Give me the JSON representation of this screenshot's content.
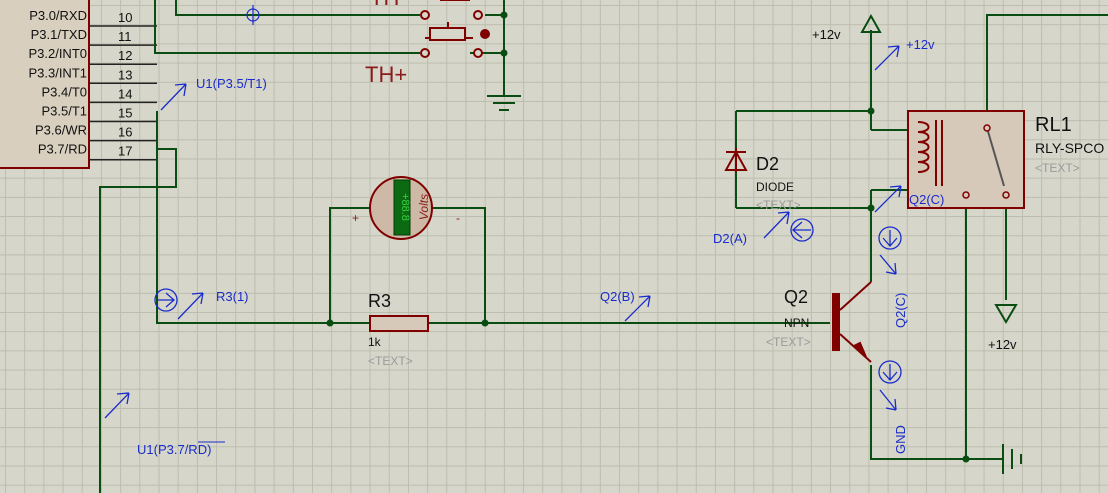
{
  "mcu": {
    "pins": [
      {
        "name": "P3.0/RXD",
        "num": "10"
      },
      {
        "name": "P3.1/TXD",
        "num": "11"
      },
      {
        "name": "P3.2/INT0",
        "num": "12"
      },
      {
        "name": "P3.3/INT1",
        "num": "13"
      },
      {
        "name": "P3.4/T0",
        "num": "14"
      },
      {
        "name": "P3.5/T1",
        "num": "15"
      },
      {
        "name": "P3.6/WR",
        "num": "16"
      },
      {
        "name": "P3.7/RD",
        "num": "17"
      }
    ]
  },
  "labels": {
    "th_minus": "TH-",
    "th_plus": "TH+",
    "u1_t1": "U1(P3.5/T1)",
    "u1_rd": "U1(P3.7/RD)",
    "r3_probe": "R3(1)",
    "q2b_probe": "Q2(B)",
    "d2a_probe": "D2(A)",
    "q2c_probe_top": "Q2(C)",
    "q2c_probe_side": "Q2(C)",
    "gnd_probe": "GND",
    "vcc_left": "+12v",
    "vcc_probe": "+12v",
    "vcc_bottom": "+12v"
  },
  "voltmeter": {
    "display": "+88.8",
    "unit": "Volts",
    "plus": "+",
    "minus": "-"
  },
  "r3": {
    "ref": "R3",
    "value": "1k",
    "text": "<TEXT>"
  },
  "d2": {
    "ref": "D2",
    "type": "DIODE",
    "text": "<TEXT>"
  },
  "q2": {
    "ref": "Q2",
    "type": "NPN",
    "text": "<TEXT>"
  },
  "rl1": {
    "ref": "RL1",
    "type": "RLY-SPCO",
    "text": "<TEXT>"
  },
  "colors": {
    "wire": "#0a4d12",
    "component": "#800000",
    "probe": "#1a2ccc",
    "grid": "#bcbdae",
    "background": "#d6d7ca"
  }
}
